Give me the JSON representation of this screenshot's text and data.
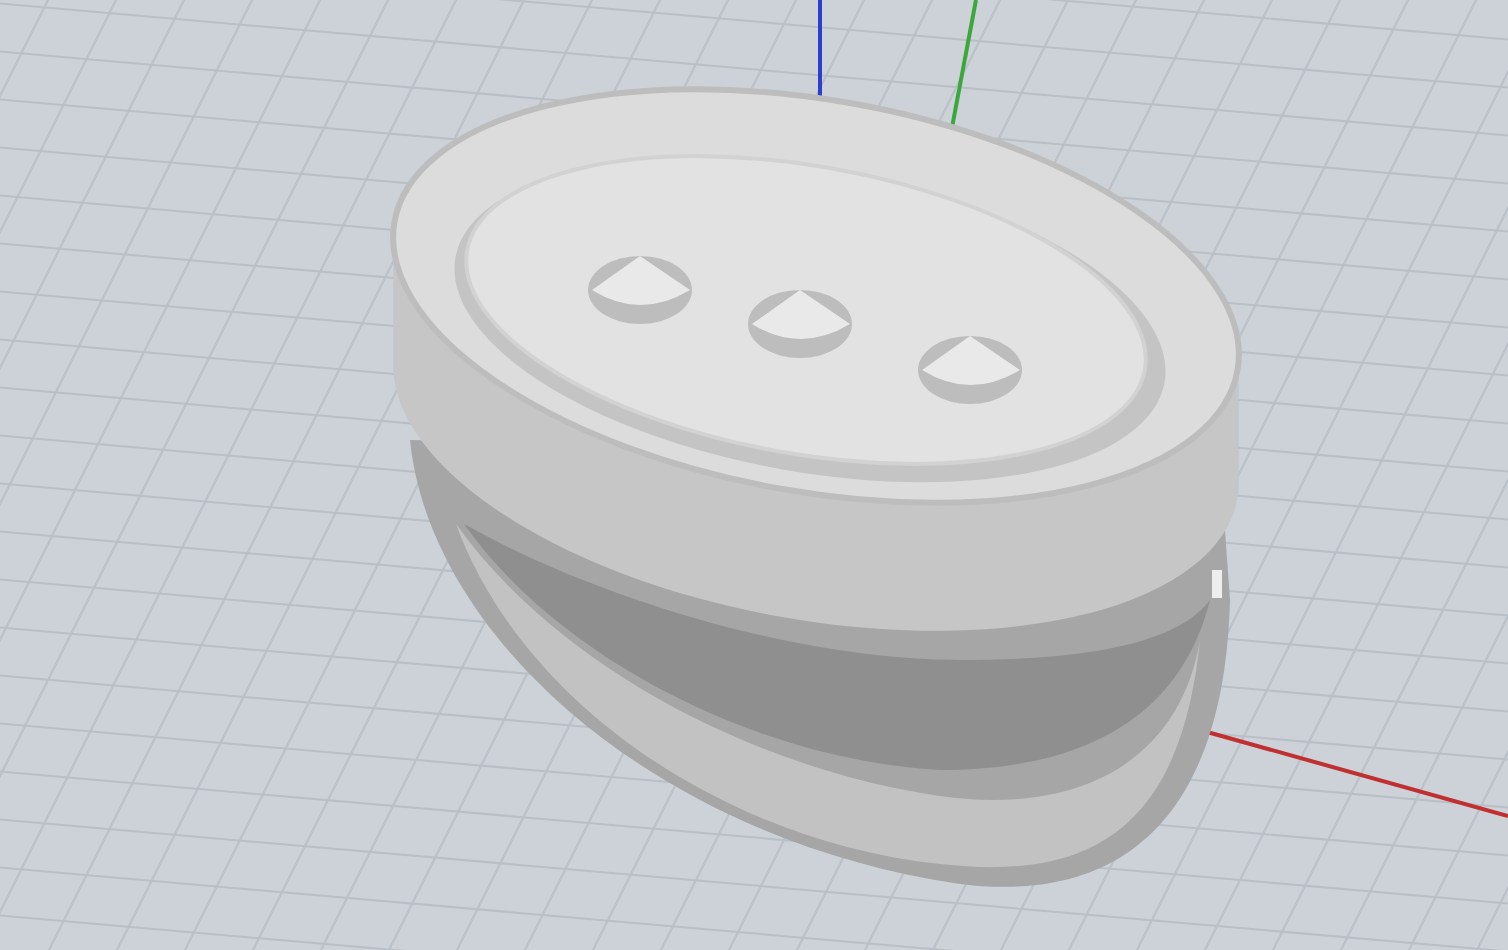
{
  "viewport": {
    "grid_shown": true,
    "axes_shown": true
  }
}
